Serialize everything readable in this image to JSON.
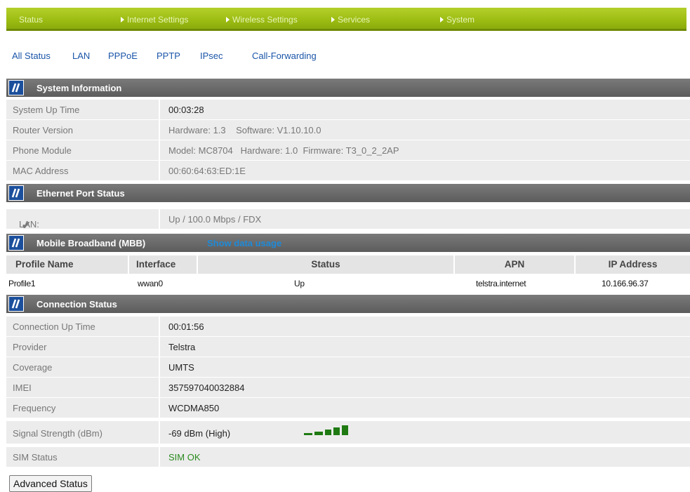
{
  "top_nav": [
    {
      "label": "Status",
      "arrow": false
    },
    {
      "label": "Internet Settings",
      "arrow": true
    },
    {
      "label": "Wireless Settings",
      "arrow": true
    },
    {
      "label": "Services",
      "arrow": true
    },
    {
      "label": "System",
      "arrow": true
    }
  ],
  "sub_nav": [
    "All Status",
    "LAN",
    "PPPoE",
    "PPTP",
    "IPsec",
    "Call-Forwarding"
  ],
  "system_info": {
    "title": "System Information",
    "rows": [
      {
        "label": "System Up Time",
        "value": "00:03:28"
      },
      {
        "label": "Router Version",
        "value": "Hardware: 1.3    Software: V1.10.10.0"
      },
      {
        "label": "Phone Module",
        "value": "Model: MC8704   Hardware: 1.0  Firmware: T3_0_2_2AP"
      },
      {
        "label": "MAC Address",
        "value": "00:60:64:63:ED:1E"
      }
    ]
  },
  "ethernet": {
    "title": "Ethernet Port Status",
    "lan_label": "LAN:",
    "lan_check": "✔",
    "lan_value": "Up / 100.0 Mbps / FDX"
  },
  "mbb": {
    "title": "Mobile Broadband (MBB)",
    "link": "Show data usage",
    "headers": [
      "Profile Name",
      "Interface",
      "Status",
      "APN",
      "IP Address"
    ],
    "rows": [
      {
        "profile": "Profile1",
        "interface": "wwan0",
        "status": "Up",
        "apn": "telstra.internet",
        "ip": "10.166.96.37"
      }
    ]
  },
  "connection": {
    "title": "Connection Status",
    "rows": [
      {
        "label": "Connection Up Time",
        "value": "00:01:56"
      },
      {
        "label": "Provider",
        "value": "Telstra"
      },
      {
        "label": "Coverage",
        "value": "UMTS"
      },
      {
        "label": "IMEI",
        "value": "357597040032884"
      },
      {
        "label": "Frequency",
        "value": "WCDMA850"
      },
      {
        "label": "Signal Strength (dBm)",
        "value": "-69 dBm (High)",
        "signal_bars": 5
      },
      {
        "label": "SIM Status",
        "value": "SIM OK"
      }
    ]
  },
  "buttons": {
    "advanced_status": "Advanced Status"
  },
  "colors": {
    "nav_green": "#9cbc13",
    "header_gray": "#666666",
    "link_blue": "#1a55a8",
    "ok_green": "#2a8a1e",
    "logo_blue": "#1b4f9c"
  }
}
